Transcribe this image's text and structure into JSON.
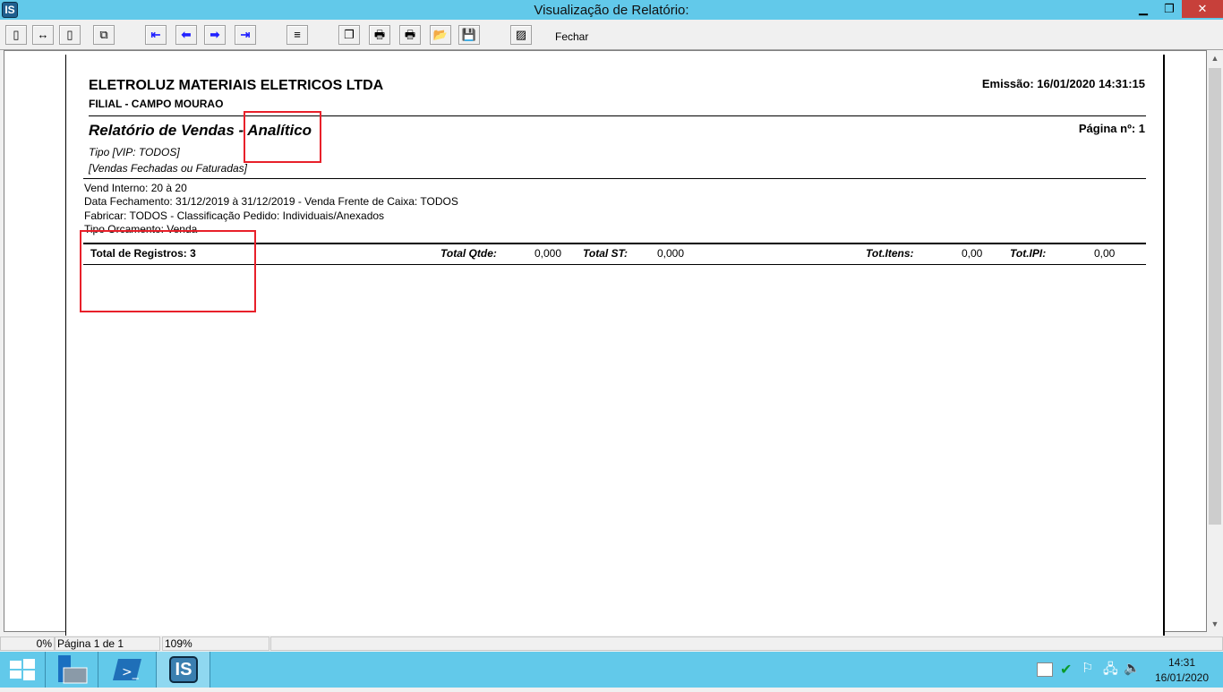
{
  "window": {
    "title": "Visualização de Relatório:",
    "app_icon": "IS",
    "minimize": "▁",
    "restore": "❐",
    "close": "✕"
  },
  "toolbar": {
    "buttons": [
      {
        "name": "page-view-button",
        "glyph": "▯"
      },
      {
        "name": "page-width-button",
        "glyph": "↔"
      },
      {
        "name": "full-page-button",
        "glyph": "▯"
      },
      {
        "name": "multi-page-button",
        "glyph": "⧉"
      },
      {
        "name": "first-page-button",
        "glyph": "⇤"
      },
      {
        "name": "prev-page-button",
        "glyph": "⬅"
      },
      {
        "name": "next-page-button",
        "glyph": "➡"
      },
      {
        "name": "last-page-button",
        "glyph": "⇥"
      },
      {
        "name": "goto-page-button",
        "glyph": "≡"
      },
      {
        "name": "copy-button",
        "glyph": "❐"
      },
      {
        "name": "print-setup-button",
        "glyph": "🖶"
      },
      {
        "name": "print-button",
        "glyph": "🖶"
      },
      {
        "name": "open-button",
        "glyph": "📂"
      },
      {
        "name": "save-button",
        "glyph": "💾"
      },
      {
        "name": "export-button",
        "glyph": "▨"
      }
    ],
    "close_label": "Fechar"
  },
  "report": {
    "company": "ELETROLUZ MATERIAIS ELETRICOS LTDA",
    "branch": "FILIAL - CAMPO MOURAO",
    "emission": "Emissão: 16/01/2020 14:31:15",
    "title": "Relatório de Vendas - Analítico",
    "page": "Página nº: 1",
    "type": "Tipo [VIP: TODOS]",
    "status": "[Vendas Fechadas ou Faturadas]",
    "filters": [
      "Vend Interno: 20 à 20",
      "Data Fechamento: 31/12/2019 à 31/12/2019 - Venda Frente de Caixa: TODOS",
      "Fabricar: TODOS - Classificação Pedido: Individuais/Anexados",
      "Tipo Orcamento: Venda"
    ],
    "totals": {
      "records": "Total de Registros: 3",
      "qtde_label": "Total Qtde:",
      "qtde": "0,000",
      "st_label": "Total ST:",
      "st": "0,000",
      "itens_label": "Tot.Itens:",
      "itens": "0,00",
      "ipi_label": "Tot.IPI:",
      "ipi": "0,00"
    }
  },
  "statusbar": {
    "progress": "0%",
    "page": "Página 1 de 1",
    "zoom": "109%"
  },
  "taskbar": {
    "clock_time": "14:31",
    "clock_date": "16/01/2020",
    "pinned": [
      "start-button",
      "server-manager",
      "powershell",
      "is-app"
    ]
  },
  "highlight_color": "#e8202a"
}
